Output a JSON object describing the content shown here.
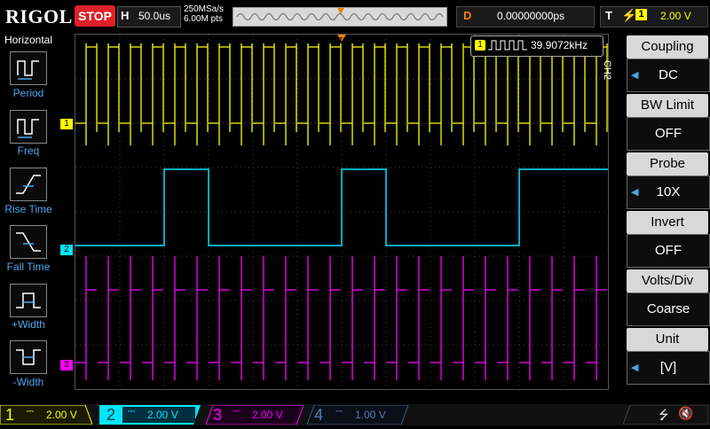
{
  "topbar": {
    "logo": "RIGOL",
    "run_status": "STOP",
    "h_label": "H",
    "timebase": "50.0us",
    "sample_rate": "250MSa/s",
    "memory_depth": "6.00M pts",
    "delay_label": "D",
    "delay_value": "0.00000000ps",
    "trigger_label": "T",
    "trigger_source": "1",
    "trigger_level": "2.00 V"
  },
  "left_panel": {
    "title": "Horizontal",
    "items": [
      {
        "label": "Period",
        "icon": "period-icon"
      },
      {
        "label": "Freq",
        "icon": "freq-icon"
      },
      {
        "label": "Rise Time",
        "icon": "rise-time-icon"
      },
      {
        "label": "Fall Time",
        "icon": "fall-time-icon"
      },
      {
        "label": "+Width",
        "icon": "pos-width-icon"
      },
      {
        "label": "-Width",
        "icon": "neg-width-icon"
      }
    ]
  },
  "measurement": {
    "channel": "1",
    "value": "39.9072kHz"
  },
  "right_menu": {
    "channel": "CH2",
    "items": [
      {
        "header": "Coupling",
        "value": "DC"
      },
      {
        "header": "BW Limit",
        "value": "OFF"
      },
      {
        "header": "Probe",
        "value": "10X"
      },
      {
        "header": "Invert",
        "value": "OFF"
      },
      {
        "header": "Volts/Div",
        "value": "Coarse"
      },
      {
        "header": "Unit",
        "value": "[V]"
      }
    ]
  },
  "channels": [
    {
      "num": "1",
      "scale": "2.00 V",
      "color": "#ffff00"
    },
    {
      "num": "2",
      "scale": "2.00 V",
      "color": "#00e5ff"
    },
    {
      "num": "3",
      "scale": "2.00 V",
      "color": "#ff00ff"
    },
    {
      "num": "4",
      "scale": "1.00 V",
      "color": "#3a5a8a"
    }
  ],
  "colors": {
    "ch1": "#ffff00",
    "ch2": "#00e5ff",
    "ch3": "#ff00ff",
    "ch4": "#3a5a8a",
    "stop": "#e0202a",
    "accent": "#4aa8e8",
    "trigger": "#f08000"
  }
}
